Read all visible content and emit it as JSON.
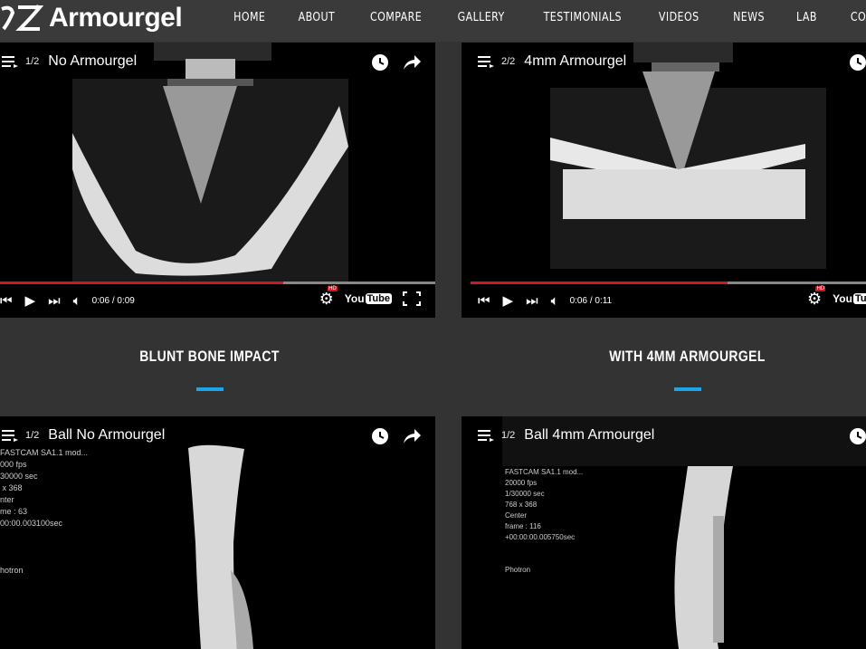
{
  "brand": {
    "name": "Armourgel",
    "reg": "®"
  },
  "nav": [
    "HOME",
    "ABOUT",
    "COMPARE",
    "GALLERY",
    "TESTIMONIALS",
    "VIDEOS",
    "NEWS",
    "LAB",
    "CONTACT"
  ],
  "videos": [
    {
      "count": "1/2",
      "title": "No Armourgel",
      "time": "0:06 / 0:09",
      "progress": 0.65
    },
    {
      "count": "2/2",
      "title": "4mm Armourgel",
      "time": "0:06 / 0:11",
      "progress": 0.65
    },
    {
      "count": "1/2",
      "title": "Ball No Armourgel",
      "overlay": "FASTCAM SA1.1 mod...\n000 fps\n30000 sec\n x 368\nnter\nme : 63\n00:00.003100sec\n\n\n\nhotron"
    },
    {
      "count": "1/2",
      "title": "Ball 4mm Armourgel",
      "overlay": "FASTCAM SA1.1 mod...\n20000 fps\n1/30000 sec\n768 x 368\nCenter\nframe : 116\n+00:00:00.005750sec\n\n\nPhotron"
    }
  ],
  "captions": {
    "left": "BLUNT BONE IMPACT",
    "right": "WITH 4MM ARMOURGEL"
  },
  "youtube": {
    "you": "You",
    "tube": "Tube"
  },
  "hd_badge": "HD",
  "colors": {
    "accent": "#1ea5e9",
    "progress": "#cc181e",
    "header": "#3a3a3a",
    "background": "#333333"
  }
}
